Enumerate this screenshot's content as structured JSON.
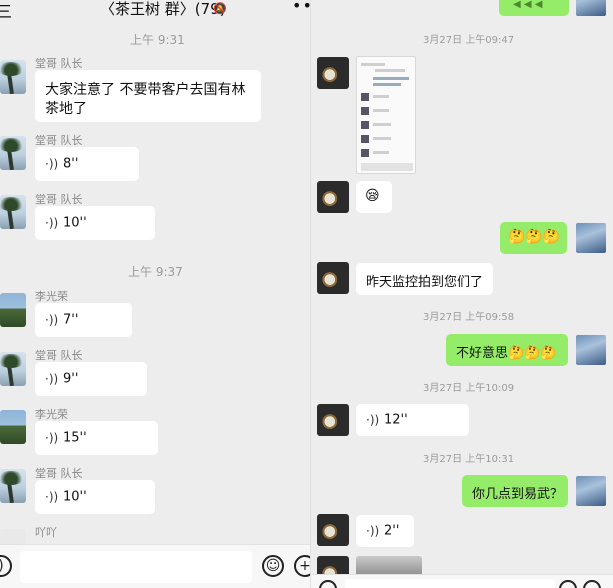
{
  "left_header": {
    "back": "三",
    "title": "〈茶王树 群〉(79)",
    "mute_icon": "mute-bell-icon",
    "more": "••"
  },
  "left_messages": {
    "ts1": "上午 9:31",
    "m1": {
      "sender": "堂哥 队长",
      "line1": "大家注意了 不要带客户去国有林",
      "line2": "茶地了"
    },
    "m2": {
      "sender": "堂哥 队长",
      "duration": "8''"
    },
    "m3": {
      "sender": "堂哥 队长",
      "duration": "10''"
    },
    "ts2": "上午 9:37",
    "m4": {
      "sender": "李光荣",
      "duration": "7''"
    },
    "m5": {
      "sender": "堂哥 队长",
      "duration": "9''"
    },
    "m6": {
      "sender": "李光荣",
      "duration": "15''"
    },
    "m7": {
      "sender": "堂哥 队长",
      "duration": "10''"
    },
    "m8": {
      "sender": "吖吖"
    }
  },
  "left_input": {
    "voice_icon": "voice-toggle-icon",
    "emoji_icon": "emoji-icon",
    "plus_icon": "plus-icon"
  },
  "right_messages": {
    "top_bubble": "◀ ◀ ◀",
    "ts1": "3月27日 上午09:47",
    "r_emoji1": "😪",
    "r_out1": "🤔🤔🤔",
    "r_text1": "昨天监控拍到您们了",
    "ts2": "3月27日 上午09:58",
    "r_out2": "不好意思🤔🤔🤔",
    "ts3": "3月27日 上午10:09",
    "r_voice1": "12''",
    "ts4": "3月27日 上午10:31",
    "r_out3": "你几点到易武？",
    "r_voice2": "2''"
  },
  "voice_icon_glyph": "·))",
  "colors": {
    "background": "#ededed",
    "bubble_in": "#ffffff",
    "bubble_out": "#95ec69",
    "timestamp": "#9a9a9a"
  }
}
